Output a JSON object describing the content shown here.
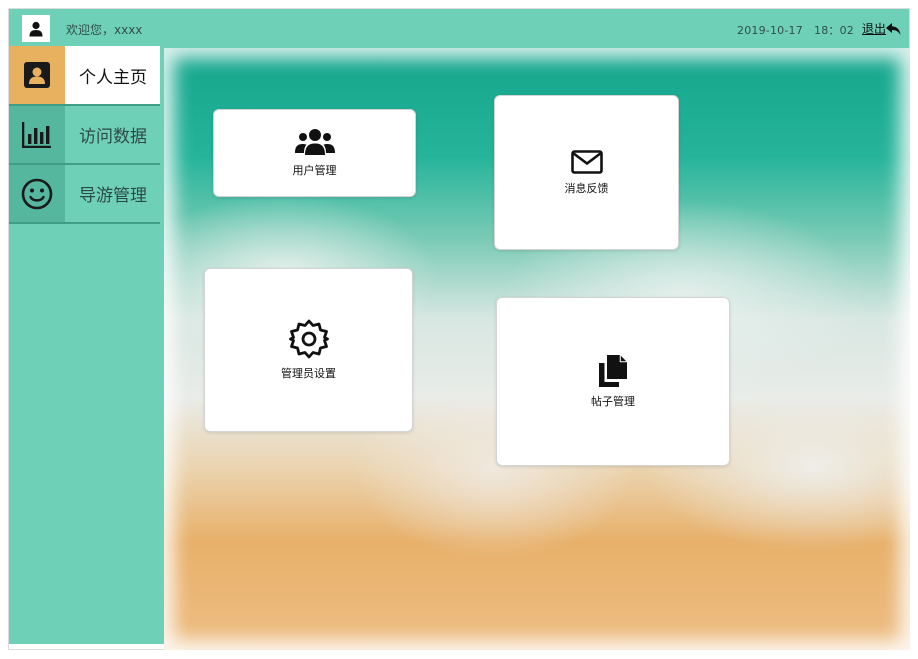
{
  "header": {
    "welcome": "欢迎您，xxxx",
    "datetime": "2019-10-17   18：02",
    "logout_label": "退出",
    "avatar_icon": "user-icon",
    "logout_icon": "reply-arrow-icon"
  },
  "sidebar": {
    "items": [
      {
        "label": "个人主页",
        "icon": "user-badge-icon",
        "active": true
      },
      {
        "label": "访问数据",
        "icon": "bar-chart-icon",
        "active": false
      },
      {
        "label": "导游管理",
        "icon": "smiley-icon",
        "active": false
      }
    ]
  },
  "cards": [
    {
      "label": "用户管理",
      "icon": "users-icon"
    },
    {
      "label": "消息反馈",
      "icon": "envelope-icon"
    },
    {
      "label": "管理员设置",
      "icon": "gear-icon"
    },
    {
      "label": "帖子管理",
      "icon": "copy-icon"
    }
  ],
  "colors": {
    "header_bg": "#6fd0b8",
    "active_icon_bg": "#e8b160",
    "inactive_icon_bg": "#55b79e"
  }
}
